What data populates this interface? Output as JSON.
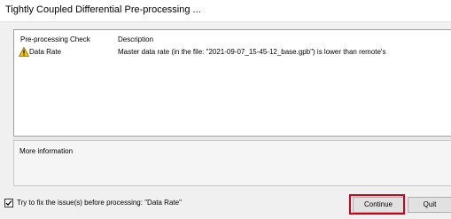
{
  "window": {
    "title": "Tightly Coupled Differential Pre-processing ..."
  },
  "list": {
    "columns": [
      "Pre-processing Check",
      "Description"
    ],
    "rows": [
      {
        "check": "Data Rate",
        "icon": "warning-icon",
        "description": "Master data rate (in the file: \"2021-09-07_15-45-12_base.gpb\") is lower than remote's"
      }
    ]
  },
  "info": {
    "label": "More information"
  },
  "options": {
    "fix_label": "Try to fix the issue(s) before processing: \"Data Rate\"",
    "fix_checked": true
  },
  "buttons": {
    "continue_label": "Continue",
    "quit_label": "Quit"
  },
  "colors": {
    "highlight": "#d4001a",
    "warning_fill": "#f5c400"
  }
}
